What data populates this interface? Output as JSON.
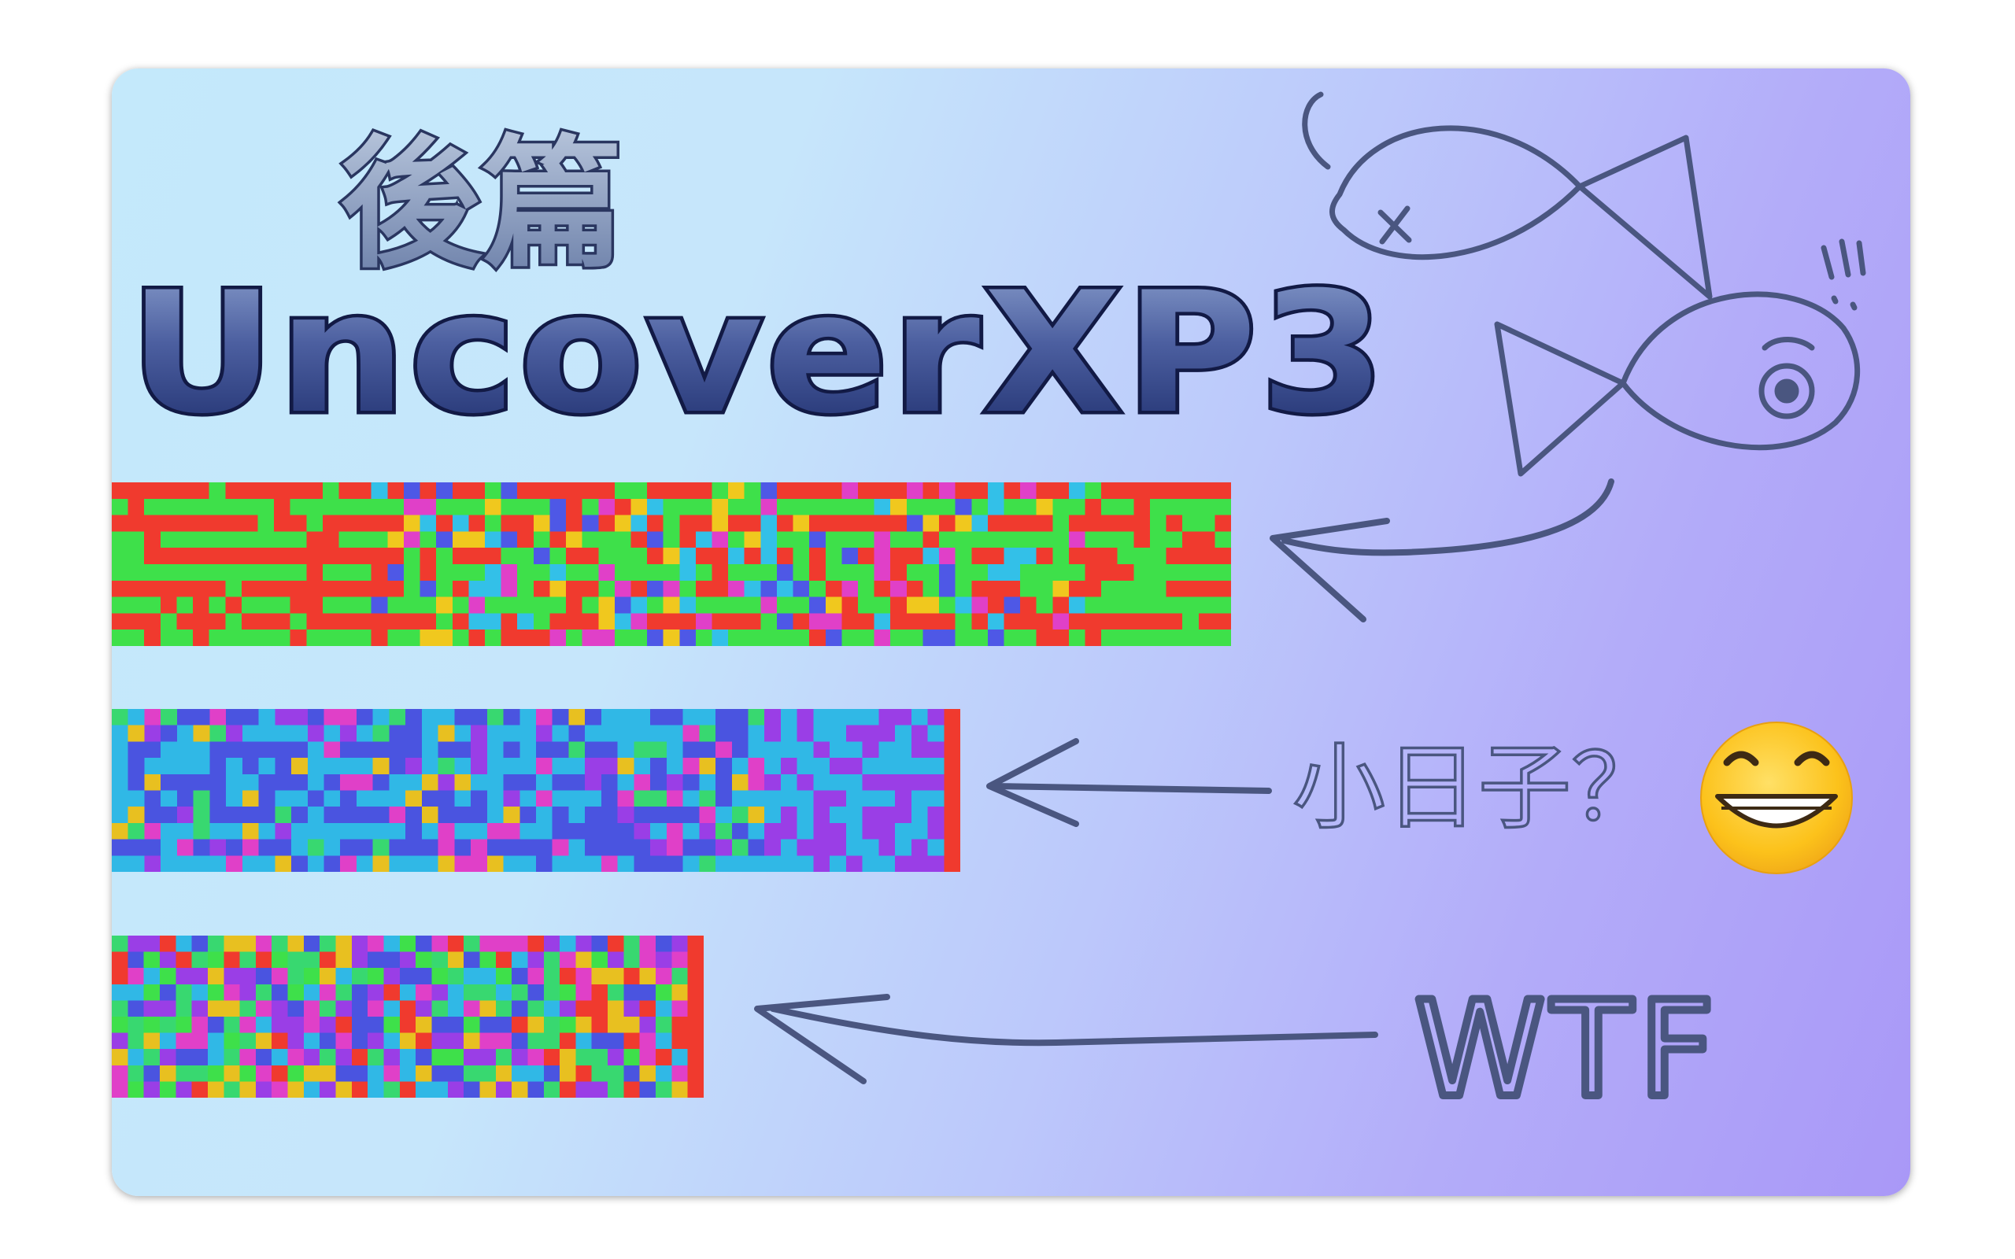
{
  "title": {
    "subtitle_cjk": "後篇",
    "main": "UncoverXP3"
  },
  "annotations": {
    "middle_label": "小日子？",
    "bottom_label": "WTF"
  },
  "icons": {
    "emoji": "grinning-face-emoji",
    "fish": "fish-doodle",
    "arrow": "arrow-left"
  },
  "colors": {
    "bg_left": "#c4e9fb",
    "bg_right": "#a998f7",
    "ink": "#4a5680",
    "title_dark": "#1f2f6e",
    "title_light": "#7f93c6"
  },
  "strips": [
    {
      "name": "entropy-strip-1",
      "palette": [
        "#f03a2e",
        "#3ee04a",
        "#f03a2e",
        "#3ee04a",
        "#f0c81e",
        "#4e58e6",
        "#e040c8",
        "#33c0e8"
      ]
    },
    {
      "name": "entropy-strip-2",
      "palette": [
        "#4a54e0",
        "#30b8e6",
        "#4a54e0",
        "#30b8e6",
        "#9a3ee6",
        "#38d870",
        "#e040c8",
        "#e8c020"
      ]
    },
    {
      "name": "entropy-strip-3",
      "palette": [
        "#f03a2e",
        "#3ee04a",
        "#4a54e0",
        "#30b8e6",
        "#e040c8",
        "#e8c020",
        "#9a3ee6",
        "#38d870"
      ]
    }
  ]
}
